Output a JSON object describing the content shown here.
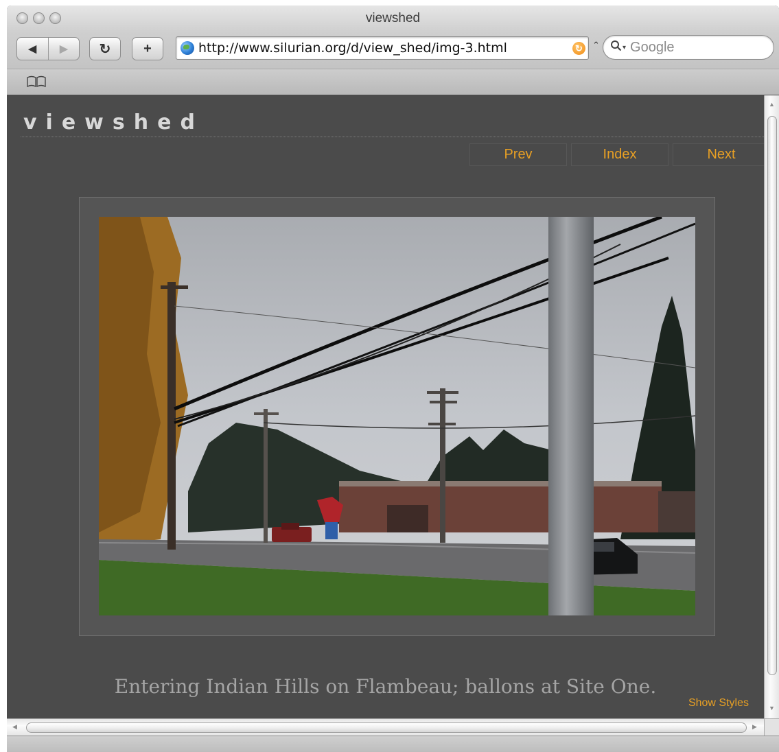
{
  "window": {
    "title": "viewshed"
  },
  "toolbar": {
    "back_glyph": "◀",
    "forward_glyph": "▶",
    "reload_glyph": "↻",
    "add_glyph": "+",
    "url": "http://www.silurian.org/d/view_shed/img-3.html",
    "caret_glyph": "⌃",
    "search_placeholder": "Google"
  },
  "page": {
    "site_title": "viewshed",
    "nav": {
      "prev": "Prev",
      "index": "Index",
      "next": "Next"
    },
    "caption": "Entering Indian Hills on Flambeau; ballons at Site One.",
    "show_styles": "Show Styles"
  },
  "colors": {
    "page_background": "#4b4b4b",
    "nav_link": "#e8a024",
    "caption": "#a5a5a5"
  },
  "icons": [
    "back-icon",
    "forward-icon",
    "reload-icon",
    "add-bookmark-icon",
    "globe-icon",
    "rss-icon",
    "search-icon",
    "bookmarks-book-icon"
  ]
}
